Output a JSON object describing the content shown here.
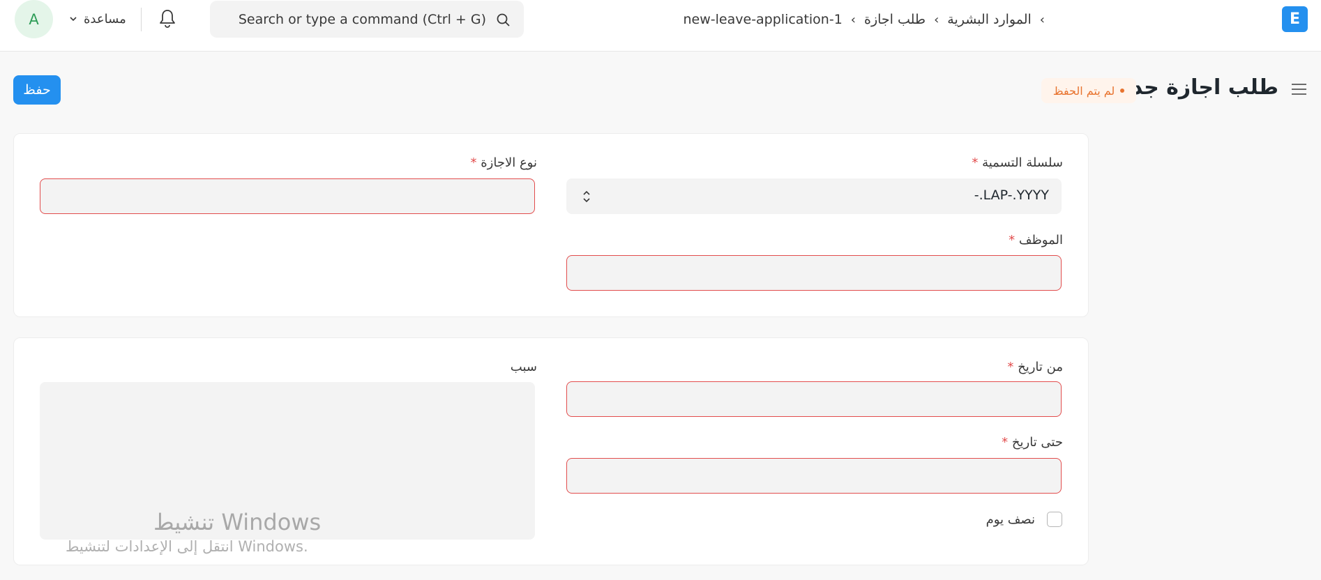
{
  "navbar": {
    "avatar_initial": "A",
    "help_label": "مساعدة",
    "search_placeholder": "Search or type a command (Ctrl + G)",
    "breadcrumbs": [
      "new-leave-application-1",
      "طلب اجازة",
      "الموارد البشرية"
    ],
    "logo_letter": "E"
  },
  "page": {
    "title": "طلب اجازة جديد",
    "status": "لم يتم الحفظ",
    "save_label": "حفظ"
  },
  "form": {
    "naming_series": {
      "label": "سلسلة التسمية",
      "required_mark": "*",
      "value": "-.LAP-.YYYY"
    },
    "leave_type": {
      "label": "نوع الاجازة",
      "required_mark": "*",
      "value": ""
    },
    "employee": {
      "label": "الموظف",
      "required_mark": "*",
      "value": ""
    },
    "from_date": {
      "label": "من تاريخ",
      "required_mark": "*",
      "value": ""
    },
    "to_date": {
      "label": "حتى تاريخ",
      "required_mark": "*",
      "value": ""
    },
    "half_day": {
      "label": "نصف يوم",
      "checked": false
    },
    "reason": {
      "label": "سبب",
      "value": ""
    }
  },
  "watermark": {
    "title": "تنشيط Windows",
    "subtitle": "انتقل إلى الإعدادات لتنشيط Windows."
  },
  "colors": {
    "primary": "#2490ef",
    "error_border": "#e24c4c",
    "status_text": "#e8732e",
    "status_bg": "#fff4ec"
  }
}
